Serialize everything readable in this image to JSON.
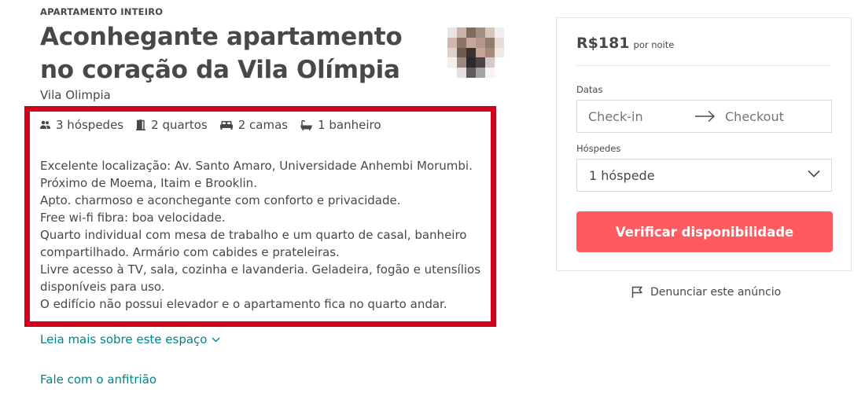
{
  "listing": {
    "type_label": "APARTAMENTO INTEIRO",
    "title": "Aconhegante apartamento no coração da Vila Olímpia",
    "location": "Vila Olimpia"
  },
  "amenities": [
    {
      "icon": "guests-icon",
      "label": "3 hóspedes"
    },
    {
      "icon": "door-icon",
      "label": "2 quartos"
    },
    {
      "icon": "bed-icon",
      "label": "2 camas"
    },
    {
      "icon": "bath-icon",
      "label": "1 banheiro"
    }
  ],
  "description": [
    "Excelente localização: Av. Santo Amaro, Universidade Anhembi Morumbi.",
    "Próximo de Moema, Itaim e Brooklin.",
    "Apto. charmoso e aconchegante com conforto e privacidade.",
    "Free wi-fi fibra: boa velocidade.",
    "Quarto individual com mesa de trabalho e um quarto de casal, banheiro",
    "compartilhado. Armário com cabides e prateleiras.",
    "Livre acesso à TV, sala, cozinha e lavanderia. Geladeira, fogão e utensílios",
    "disponíveis para uso.",
    "O edifício não possui elevador e o apartamento fica no quarto andar."
  ],
  "links": {
    "read_more": "Leia mais sobre este espaço",
    "contact_host": "Fale com o anfitrião"
  },
  "booking": {
    "price": "R$181",
    "per_night": "por noite",
    "dates_label": "Datas",
    "checkin_placeholder": "Check-in",
    "checkout_placeholder": "Checkout",
    "guests_label": "Hóspedes",
    "guests_value": "1 hóspede",
    "check_button": "Verificar disponibilidade"
  },
  "report": {
    "label": "Denunciar este anúncio"
  },
  "colors": {
    "accent": "#ff5a5f",
    "link": "#008489",
    "highlight": "#d0021b",
    "text": "#484848"
  }
}
